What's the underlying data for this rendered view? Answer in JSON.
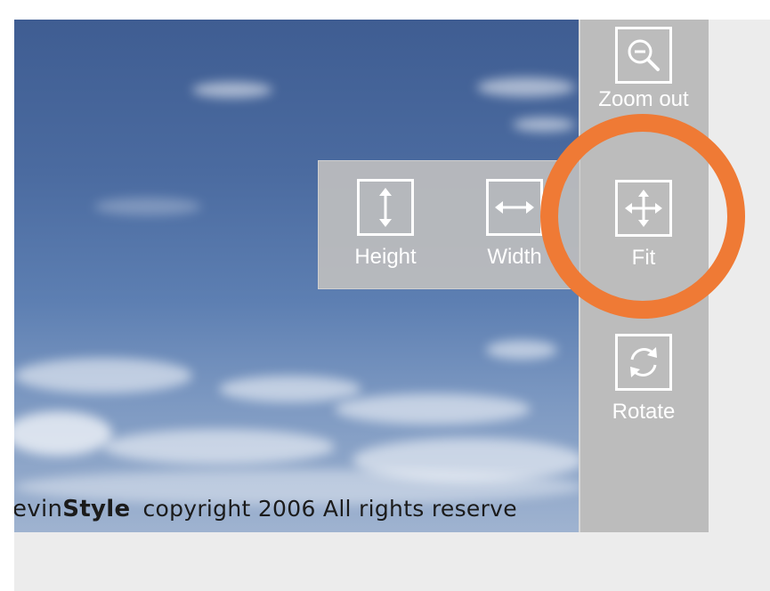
{
  "photo": {
    "caption_partial_brand": "evin",
    "caption_brand_bold": "Style",
    "caption_copyright": "copyright 2006 All rights reserve"
  },
  "toolbar": {
    "zoom_out_label": "Zoom out",
    "fit_label": "Fit",
    "rotate_label": "Rotate"
  },
  "fit_menu": {
    "height_label": "Height",
    "width_label": "Width"
  },
  "colors": {
    "highlight_ring": "#ef7a35",
    "toolbar_bg": "#bcbcbc",
    "sky_top": "#3f5d92"
  },
  "icons": {
    "zoom_out": "zoom-out-icon",
    "fit": "fit-icon",
    "rotate": "rotate-icon",
    "height": "fit-height-icon",
    "width": "fit-width-icon"
  }
}
